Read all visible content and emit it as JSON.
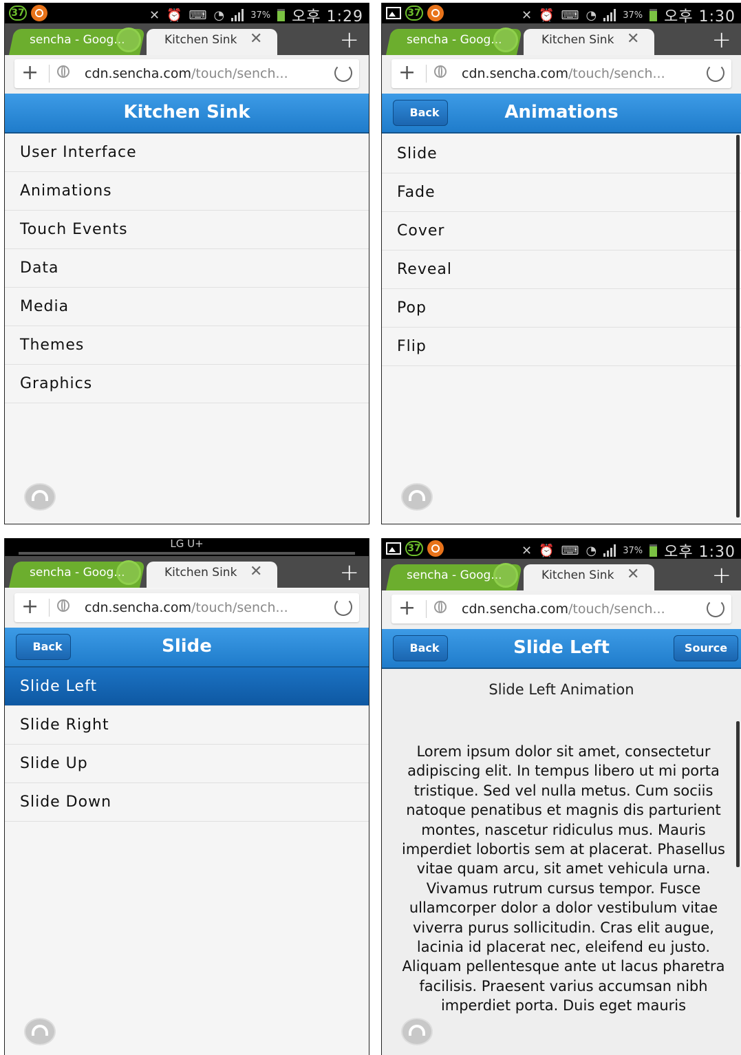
{
  "status": {
    "badge": "37",
    "battery_pct": "37%",
    "time_a": "오후 1:29",
    "time_b": "오후 1:30",
    "carrier": "LG U+"
  },
  "browser": {
    "active_tab": "sencha - Goog...",
    "inactive_tab": "Kitchen Sink",
    "url_host": "cdn.sencha.com",
    "url_path": "/touch/sench..."
  },
  "screen1": {
    "title": "Kitchen Sink",
    "items": [
      "User Interface",
      "Animations",
      "Touch Events",
      "Data",
      "Media",
      "Themes",
      "Graphics"
    ]
  },
  "screen2": {
    "back": "Back",
    "title": "Animations",
    "items": [
      "Slide",
      "Fade",
      "Cover",
      "Reveal",
      "Pop",
      "Flip"
    ]
  },
  "screen3": {
    "back": "Back",
    "title": "Slide",
    "items": [
      "Slide Left",
      "Slide Right",
      "Slide Up",
      "Slide Down"
    ]
  },
  "screen4": {
    "back": "Back",
    "title": "Slide Left",
    "source": "Source",
    "content_title": "Slide Left Animation",
    "content_body": "Lorem ipsum dolor sit amet, consectetur adipiscing elit. In tempus libero ut mi porta tristique. Sed vel nulla metus. Cum sociis natoque penatibus et magnis dis parturient montes, nascetur ridiculus mus. Mauris imperdiet lobortis sem at placerat. Phasellus vitae quam arcu, sit amet vehicula urna. Vivamus rutrum cursus tempor. Fusce ullamcorper dolor a dolor vestibulum vitae viverra purus sollicitudin. Cras elit augue, lacinia id placerat nec, eleifend eu justo. Aliquam pellentesque ante ut lacus pharetra facilisis. Praesent varius accumsan nibh imperdiet porta. Duis eget mauris"
  },
  "colors": {
    "navbar": "#2a8ad8",
    "selected_row": "#1565b5",
    "tab_active": "#6cae2e"
  },
  "icons": [
    "mute-icon",
    "alarm-icon",
    "keyboard-icon",
    "wifi-icon",
    "signal-icon",
    "battery-icon",
    "new-tab-icon",
    "close-tab-icon",
    "globe-icon",
    "reload-icon",
    "quick-controls-icon"
  ]
}
